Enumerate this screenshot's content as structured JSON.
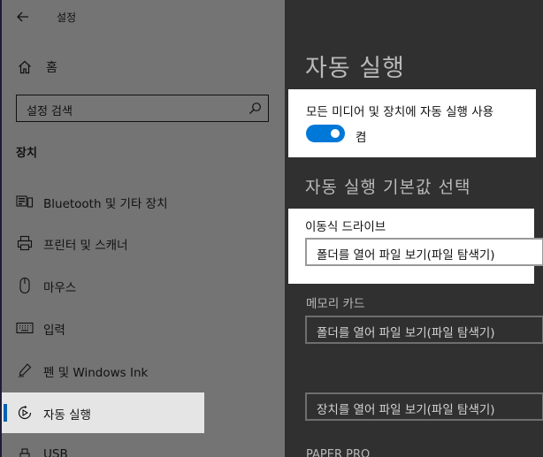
{
  "window": {
    "title": "설정"
  },
  "sidebar": {
    "home_label": "홈",
    "search_placeholder": "설정 검색",
    "section_header": "장치",
    "items": [
      {
        "label": "Bluetooth 및 기타 장치",
        "icon": "bluetooth-devices-icon"
      },
      {
        "label": "프린터 및 스캐너",
        "icon": "printer-icon"
      },
      {
        "label": "마우스",
        "icon": "mouse-icon"
      },
      {
        "label": "입력",
        "icon": "keyboard-icon"
      },
      {
        "label": "펜 및 Windows Ink",
        "icon": "pen-icon"
      },
      {
        "label": "자동 실행",
        "icon": "autoplay-icon",
        "selected": true
      },
      {
        "label": "USB",
        "icon": "usb-icon"
      }
    ]
  },
  "main": {
    "title": "자동 실행",
    "toggle": {
      "label": "모든 미디어 및 장치에 자동 실행 사용",
      "state": "켬",
      "on": true
    },
    "defaults_title": "자동 실행 기본값 선택",
    "removable_drive": {
      "label": "이동식 드라이브",
      "value": "폴더를 열어 파일 보기(파일 탐색기)"
    },
    "memory_card": {
      "label": "메모리 카드",
      "value": "폴더를 열어 파일 보기(파일 탐색기)"
    },
    "device": {
      "value": "장치를 열어 파일 보기(파일 탐색기)"
    },
    "device_label": "PAPER PRO"
  },
  "colors": {
    "accent": "#0078d7",
    "selected_bg": "#e5e5e5",
    "sidebar_bg": "#747474",
    "content_bg": "#303030"
  }
}
